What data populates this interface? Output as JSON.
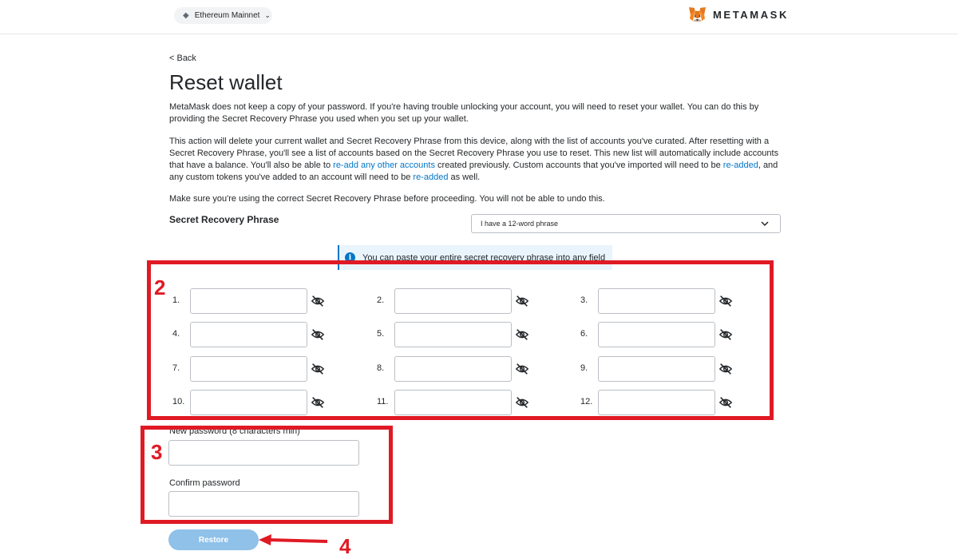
{
  "header": {
    "network": "Ethereum Mainnet",
    "logo_text": "METAMASK"
  },
  "page": {
    "back_label": "< Back",
    "title": "Reset wallet",
    "paragraph1": "MetaMask does not keep a copy of your password. If you're having trouble unlocking your account, you will need to reset your wallet. You can do this by providing the Secret Recovery Phrase you used when you set up your wallet.",
    "paragraph2_parts": {
      "a": "This action will delete your current wallet and Secret Recovery Phrase from this device, along with the list of accounts you've curated. After resetting with a Secret Recovery Phrase, you'll see a list of accounts based on the Secret Recovery Phrase you use to reset. This new list will automatically include accounts that have a balance. You'll also be able to ",
      "link1": "re-add any other accounts",
      "b": " created previously. Custom accounts that you've imported will need to be ",
      "link2": "re-added",
      "c": ", and any custom tokens you've added to an account will need to be ",
      "link3": "re-added",
      "d": " as well."
    },
    "paragraph3": "Make sure you're using the correct Secret Recovery Phrase before proceeding. You will not be able to undo this."
  },
  "srp": {
    "label": "Secret Recovery Phrase",
    "selected_option": "I have a 12-word phrase",
    "info_text": "You can paste your entire secret recovery phrase into any field",
    "words": [
      {
        "number": "1.",
        "value": ""
      },
      {
        "number": "2.",
        "value": ""
      },
      {
        "number": "3.",
        "value": ""
      },
      {
        "number": "4.",
        "value": ""
      },
      {
        "number": "5.",
        "value": ""
      },
      {
        "number": "6.",
        "value": ""
      },
      {
        "number": "7.",
        "value": ""
      },
      {
        "number": "8.",
        "value": ""
      },
      {
        "number": "9.",
        "value": ""
      },
      {
        "number": "10.",
        "value": ""
      },
      {
        "number": "11.",
        "value": ""
      },
      {
        "number": "12.",
        "value": ""
      }
    ]
  },
  "password": {
    "new_label": "New password (8 characters min)",
    "new_value": "",
    "confirm_label": "Confirm password",
    "confirm_value": ""
  },
  "actions": {
    "restore_label": "Restore"
  },
  "annotations": {
    "labels": [
      "2",
      "3",
      "4"
    ],
    "color": "#e01a24"
  },
  "colors": {
    "link": "#0376c9",
    "button_disabled": "#8fc1e9"
  }
}
